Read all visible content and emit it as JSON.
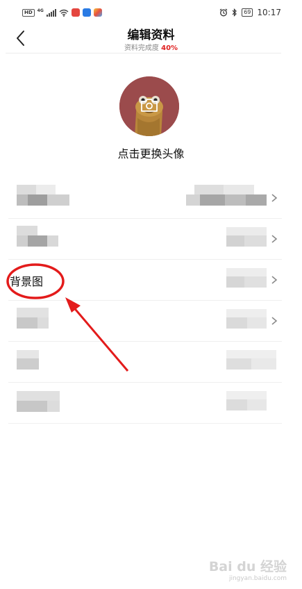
{
  "status_bar": {
    "network_left": "HD",
    "network_gen": "4G",
    "battery": "69",
    "time": "10:17"
  },
  "header": {
    "title": "编辑资料",
    "completion_label": "资料完成度",
    "completion_value": "40%"
  },
  "avatar": {
    "caption": "点击更换头像"
  },
  "rows": [
    {
      "label": "",
      "has_chevron": true
    },
    {
      "label": "",
      "has_chevron": true
    },
    {
      "label": "背景图",
      "has_chevron": true
    },
    {
      "label": "",
      "has_chevron": true
    },
    {
      "label": "",
      "has_chevron": false
    },
    {
      "label": "",
      "has_chevron": false
    }
  ],
  "watermark": {
    "logo": "Bai du 经验",
    "url": "jingyan.baidu.com"
  },
  "colors": {
    "accent_red": "#e02020",
    "avatar_bg": "#9b4b4c"
  },
  "icons": {
    "back": "chevron-left-icon",
    "camera": "camera-icon",
    "row_arrow": "chevron-right-icon"
  }
}
